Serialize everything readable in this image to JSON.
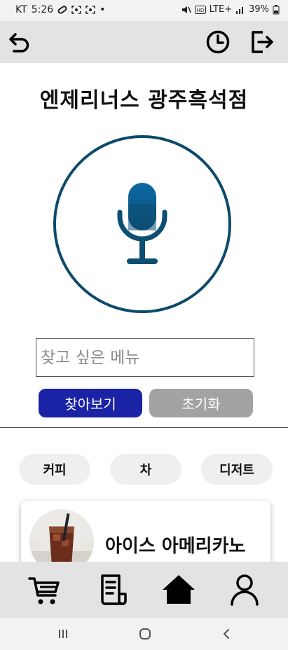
{
  "status": {
    "carrier": "KT",
    "time": "5:26",
    "dot": "•",
    "network": "LTE+",
    "battery": "39%"
  },
  "header": {
    "back_icon": "undo-arrow-icon",
    "history_icon": "clock-icon",
    "logout_icon": "exit-door-icon"
  },
  "store": {
    "name": "엔제리너스 광주흑석점"
  },
  "voice": {
    "mic_icon": "microphone-icon",
    "ring_color": "#0d4a6a",
    "mic_color": "#0a6aa5"
  },
  "search": {
    "placeholder": "찾고 싶은 메뉴",
    "value": "",
    "search_label": "찾아보기",
    "reset_label": "초기화",
    "search_color": "#1a22a6",
    "reset_color": "#a3a3a3"
  },
  "categories": [
    {
      "label": "커피"
    },
    {
      "label": "차"
    },
    {
      "label": "디저트"
    }
  ],
  "menu_items": [
    {
      "name": "아이스 아메리카노",
      "image": "iced-americano-image"
    }
  ],
  "bottom_nav": [
    {
      "icon": "cart-icon"
    },
    {
      "icon": "receipt-icon"
    },
    {
      "icon": "home-icon"
    },
    {
      "icon": "person-icon"
    }
  ],
  "system_nav": {
    "recents": "|||",
    "home": "○",
    "back": "<"
  }
}
